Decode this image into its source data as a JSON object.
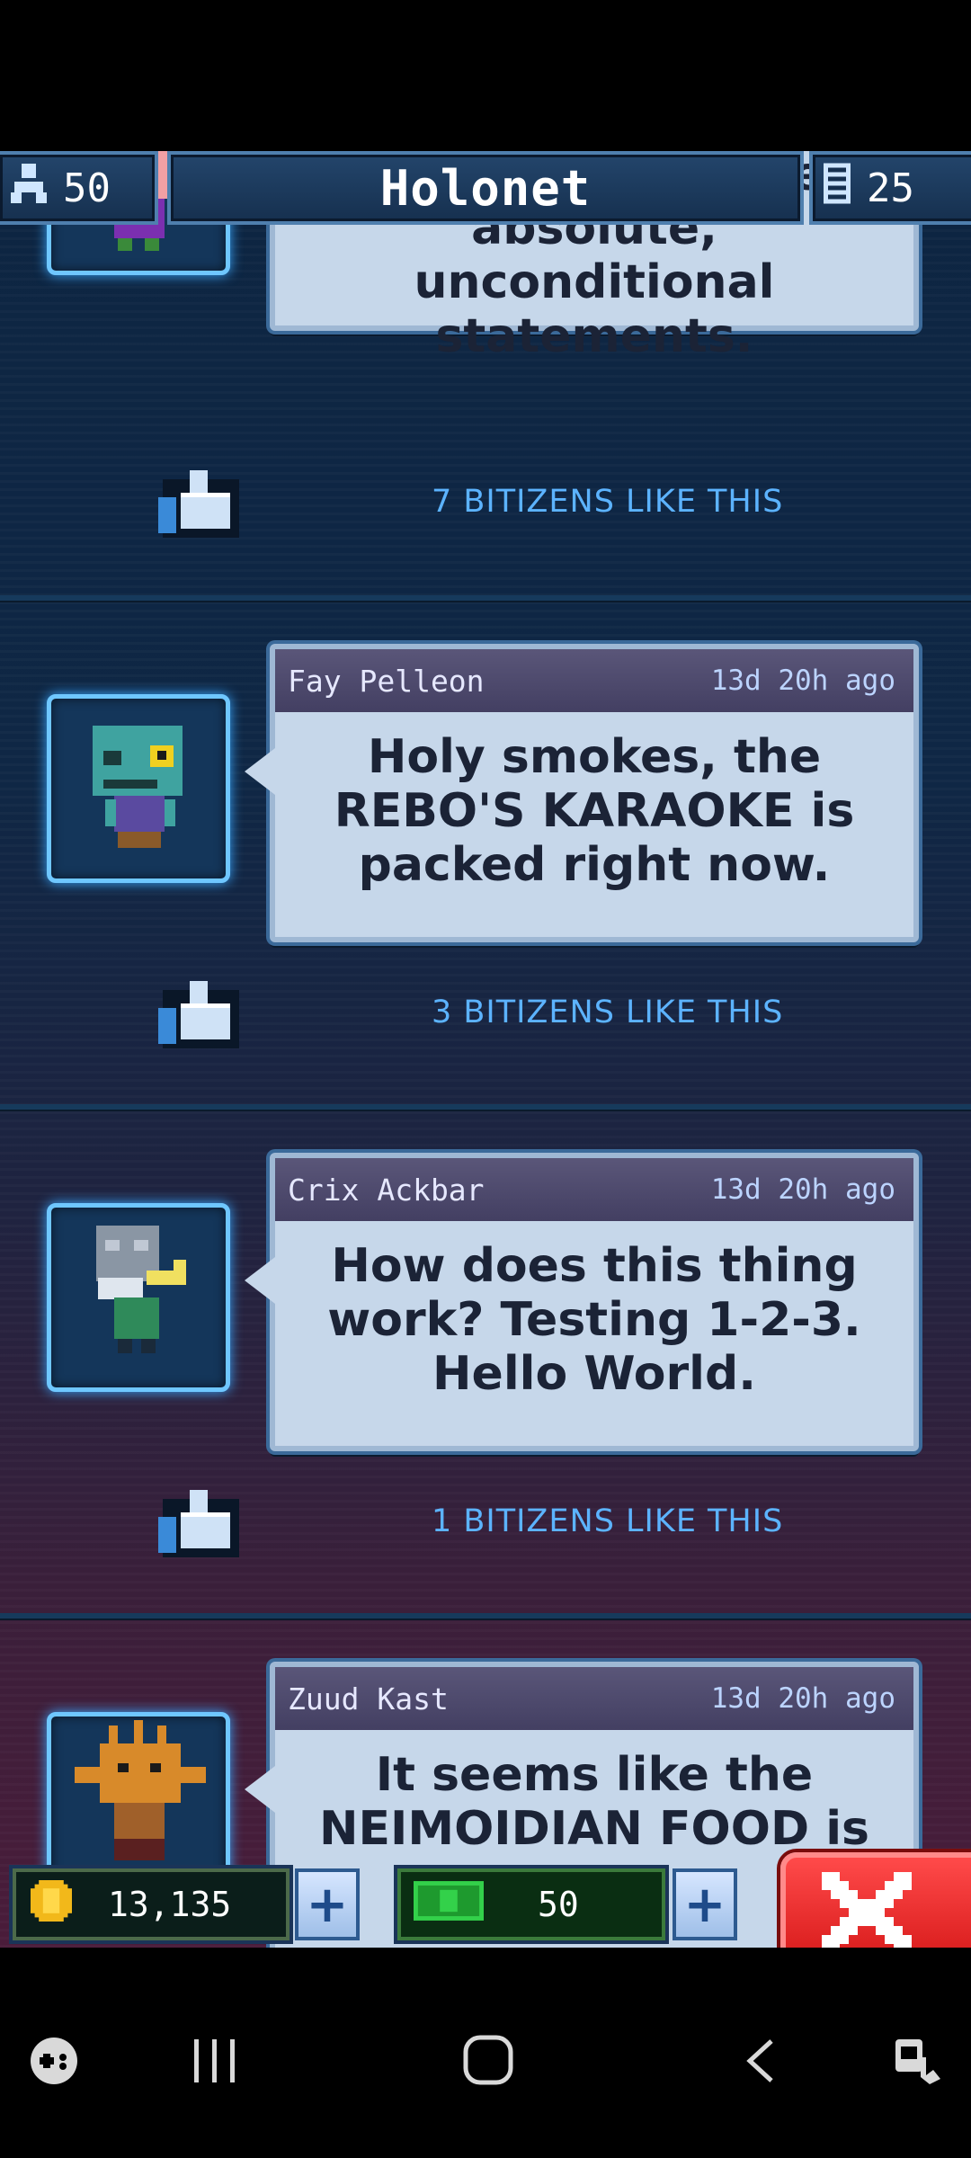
{
  "header": {
    "population": "50",
    "title": "Holonet",
    "floors": "25"
  },
  "posts": [
    {
      "author": "",
      "time": "",
      "message": "Never, ever make absolute, unconditional statements.",
      "likes": "7 BITIZENS LIKE THIS",
      "avatar": "pink-bitizen-crown-avatar"
    },
    {
      "author": "Fay Pelleon",
      "time": "13d 20h ago",
      "message": "Holy smokes, the REBO'S KARAOKE is packed right now.",
      "likes": "3 BITIZENS LIKE THIS",
      "avatar": "green-alien-bitizen-avatar"
    },
    {
      "author": "Crix Ackbar",
      "time": "13d 20h ago",
      "message": "How does this thing work? Testing 1-2-3. Hello World.",
      "likes": "1 BITIZENS LIKE THIS",
      "avatar": "gray-mon-calamari-bitizen-avatar"
    },
    {
      "author": "Zuud Kast",
      "time": "13d 20h ago",
      "message": "It seems like the NEIMOIDIAN FOOD is",
      "likes": "",
      "avatar": "orange-alien-bitizen-avatar"
    }
  ],
  "bottombar": {
    "coins": "13,135",
    "bux": "50",
    "coin_icon": "coin-icon",
    "bux_icon": "green-bux-icon",
    "close_icon": "close-icon"
  },
  "colors": {
    "likes_text": "#5cb3ff",
    "bubble_bg": "#c6d7ea",
    "header_bar": "#433f62",
    "close_red": "#e62020"
  }
}
